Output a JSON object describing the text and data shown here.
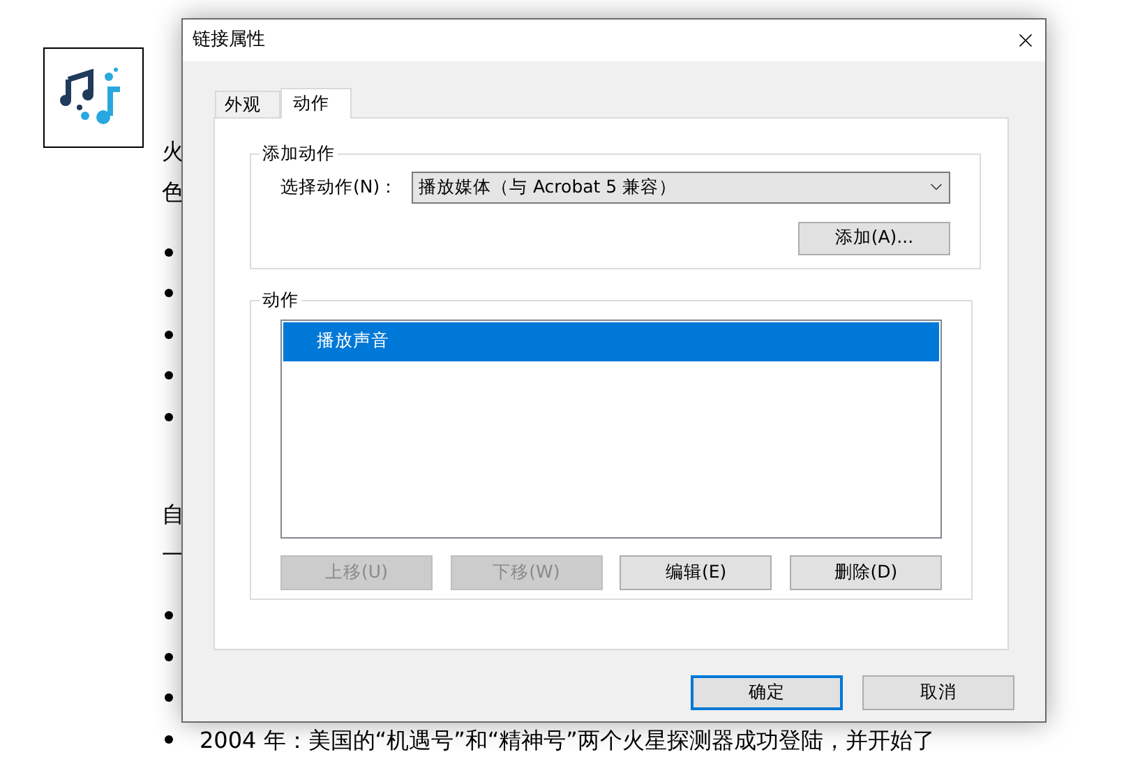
{
  "background": {
    "items": [
      {
        "kind": "text",
        "text": "火"
      },
      {
        "kind": "text",
        "text": "色"
      },
      {
        "kind": "bullet"
      },
      {
        "kind": "bullet"
      },
      {
        "kind": "bullet"
      },
      {
        "kind": "bullet"
      },
      {
        "kind": "bullet"
      },
      {
        "kind": "text",
        "text": "自"
      },
      {
        "kind": "text",
        "text": "一"
      },
      {
        "kind": "bullet"
      },
      {
        "kind": "bullet"
      },
      {
        "kind": "bullet"
      },
      {
        "kind": "bullet",
        "text": "2004 年：美国的“机遇号”和“精神号”两个火星探测器成功登陆，并开始了"
      }
    ]
  },
  "dialog": {
    "title": "链接属性",
    "tabs": [
      {
        "label": "外观",
        "selected": false
      },
      {
        "label": "动作",
        "selected": true
      }
    ],
    "add_group": {
      "legend": "添加动作",
      "label": "选择动作(N)：",
      "select_value": "播放媒体（与 Acrobat 5 兼容）",
      "button": "添加(A)..."
    },
    "actions_group": {
      "legend": "动作",
      "items": [
        {
          "label": "播放声音",
          "selected": true
        }
      ],
      "buttons": [
        {
          "label": "上移(U)",
          "disabled": true
        },
        {
          "label": "下移(W)",
          "disabled": true
        },
        {
          "label": "编辑(E)",
          "disabled": false
        },
        {
          "label": "删除(D)",
          "disabled": false
        }
      ]
    },
    "footer_buttons": [
      {
        "label": "确定",
        "default": true
      },
      {
        "label": "取消",
        "default": false
      }
    ]
  }
}
